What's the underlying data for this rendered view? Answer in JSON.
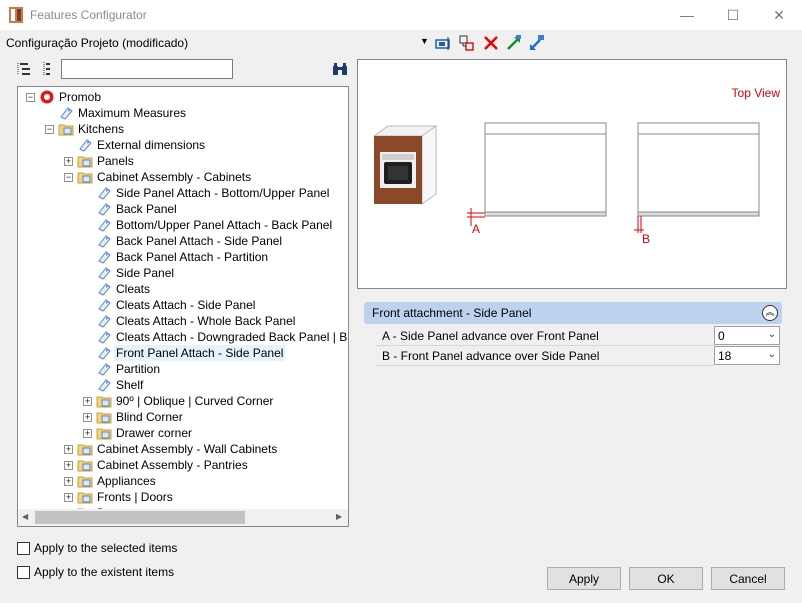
{
  "window": {
    "title": "Features Configurator",
    "minimize_glyph": "—",
    "maximize_glyph": "☐",
    "close_glyph": "✕"
  },
  "project": {
    "label": "Configuração Projeto (modificado)",
    "dropdown_glyph": "▼"
  },
  "tree_search": {
    "value": ""
  },
  "tree": {
    "expand_glyph": "+",
    "collapse_glyph": "−",
    "nodes": [
      {
        "label": "Promob",
        "level": 0,
        "icon": "promob-logo-icon",
        "exp": "−"
      },
      {
        "label": "Maximum Measures",
        "level": 1,
        "icon": "tag-icon",
        "exp": ""
      },
      {
        "label": "Kitchens",
        "level": 1,
        "icon": "folder-icon",
        "exp": "−"
      },
      {
        "label": "External dimensions",
        "level": 2,
        "icon": "tag-icon",
        "exp": ""
      },
      {
        "label": "Panels",
        "level": 2,
        "icon": "folder-icon",
        "exp": "+"
      },
      {
        "label": "Cabinet Assembly - Cabinets",
        "level": 2,
        "icon": "folder-icon",
        "exp": "−"
      },
      {
        "label": "Side Panel Attach - Bottom/Upper Panel",
        "level": 3,
        "icon": "tag-icon",
        "exp": ""
      },
      {
        "label": "Back Panel",
        "level": 3,
        "icon": "tag-icon",
        "exp": ""
      },
      {
        "label": " Bottom/Upper Panel Attach - Back Panel",
        "level": 3,
        "icon": "tag-icon",
        "exp": ""
      },
      {
        "label": "Back Panel Attach - Side Panel",
        "level": 3,
        "icon": "tag-icon",
        "exp": ""
      },
      {
        "label": "Back Panel Attach - Partition",
        "level": 3,
        "icon": "tag-icon",
        "exp": ""
      },
      {
        "label": "Side Panel",
        "level": 3,
        "icon": "tag-icon",
        "exp": ""
      },
      {
        "label": "Cleats",
        "level": 3,
        "icon": "tag-icon",
        "exp": ""
      },
      {
        "label": "Cleats Attach - Side Panel",
        "level": 3,
        "icon": "tag-icon",
        "exp": ""
      },
      {
        "label": "Cleats Attach - Whole Back Panel",
        "level": 3,
        "icon": "tag-icon",
        "exp": ""
      },
      {
        "label": "Cleats Attach - Downgraded Back Panel | Ba",
        "level": 3,
        "icon": "tag-icon",
        "exp": ""
      },
      {
        "label": "Front Panel Attach - Side Panel",
        "level": 3,
        "icon": "tag-icon",
        "exp": "",
        "selected": true
      },
      {
        "label": "Partition",
        "level": 3,
        "icon": "tag-icon",
        "exp": ""
      },
      {
        "label": "Shelf",
        "level": 3,
        "icon": "tag-icon",
        "exp": ""
      },
      {
        "label": "90º | Oblique | Curved Corner",
        "level": 3,
        "icon": "folder-icon",
        "exp": "+"
      },
      {
        "label": "Blind Corner",
        "level": 3,
        "icon": "folder-icon",
        "exp": "+"
      },
      {
        "label": "Drawer corner",
        "level": 3,
        "icon": "folder-icon",
        "exp": "+"
      },
      {
        "label": "Cabinet Assembly - Wall Cabinets",
        "level": 2,
        "icon": "folder-icon",
        "exp": "+"
      },
      {
        "label": "Cabinet Assembly - Pantries",
        "level": 2,
        "icon": "folder-icon",
        "exp": "+"
      },
      {
        "label": "Appliances",
        "level": 2,
        "icon": "folder-icon",
        "exp": "+"
      },
      {
        "label": "Fronts | Doors",
        "level": 2,
        "icon": "folder-icon",
        "exp": "+"
      },
      {
        "label": "D",
        "level": 2,
        "icon": "folder-icon",
        "exp": "+"
      }
    ],
    "scroll_up_glyph": "▲",
    "scroll_down_glyph": "▼",
    "scroll_left_glyph": "◀",
    "scroll_right_glyph": "▶"
  },
  "preview": {
    "view_label": "Top View",
    "marker_a": "A",
    "marker_b": "B"
  },
  "properties": {
    "title": "Front attachment - Side Panel",
    "collapse_glyph": "︽",
    "rows": [
      {
        "label": "A - Side Panel advance over Front Panel",
        "value": "0"
      },
      {
        "label": "B - Front Panel advance over Side Panel",
        "value": "18"
      }
    ],
    "dropdown_glyph": "⌄"
  },
  "options": {
    "apply_selected": "Apply to the selected items",
    "apply_existent": "Apply to the existent items"
  },
  "buttons": {
    "apply": "Apply",
    "ok": "OK",
    "cancel": "Cancel"
  },
  "colors": {
    "accent_red": "#e00000",
    "header_blue": "#bcd2ee",
    "cabinet_brown": "#8a4a2a"
  }
}
